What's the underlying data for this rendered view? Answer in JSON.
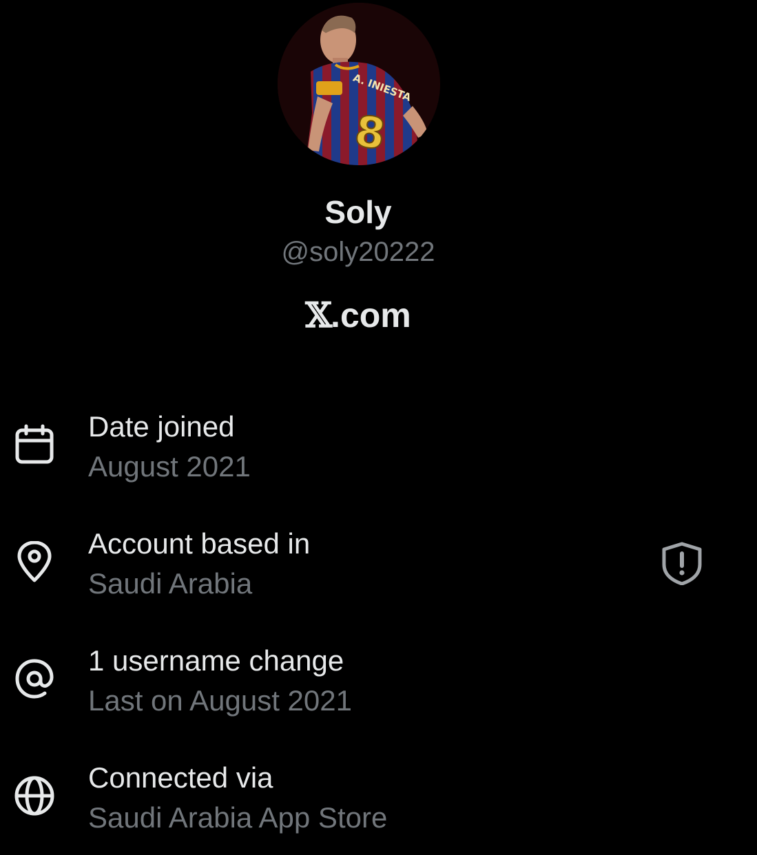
{
  "profile": {
    "avatar_alt": "Profile photo",
    "display_name": "Soly",
    "handle": "@soly20222",
    "brand_x": "𝕏",
    "brand_suffix": ".com"
  },
  "info": [
    {
      "icon": "calendar-icon",
      "title": "Date joined",
      "value": "August 2021"
    },
    {
      "icon": "location-pin-icon",
      "title": "Account based in",
      "value": "Saudi Arabia"
    },
    {
      "icon": "at-sign-icon",
      "title": "1 username change",
      "value": "Last on August 2021"
    },
    {
      "icon": "globe-icon",
      "title": "Connected via",
      "value": "Saudi Arabia App Store"
    }
  ],
  "colors": {
    "background": "#000000",
    "primary_text": "#e7e9ea",
    "secondary_text": "#71767b",
    "icon": "#e7e9ea",
    "shield_icon": "#a0a4a8"
  },
  "avatar_jersey": {
    "number": "8",
    "name": "A. INIESTA"
  }
}
